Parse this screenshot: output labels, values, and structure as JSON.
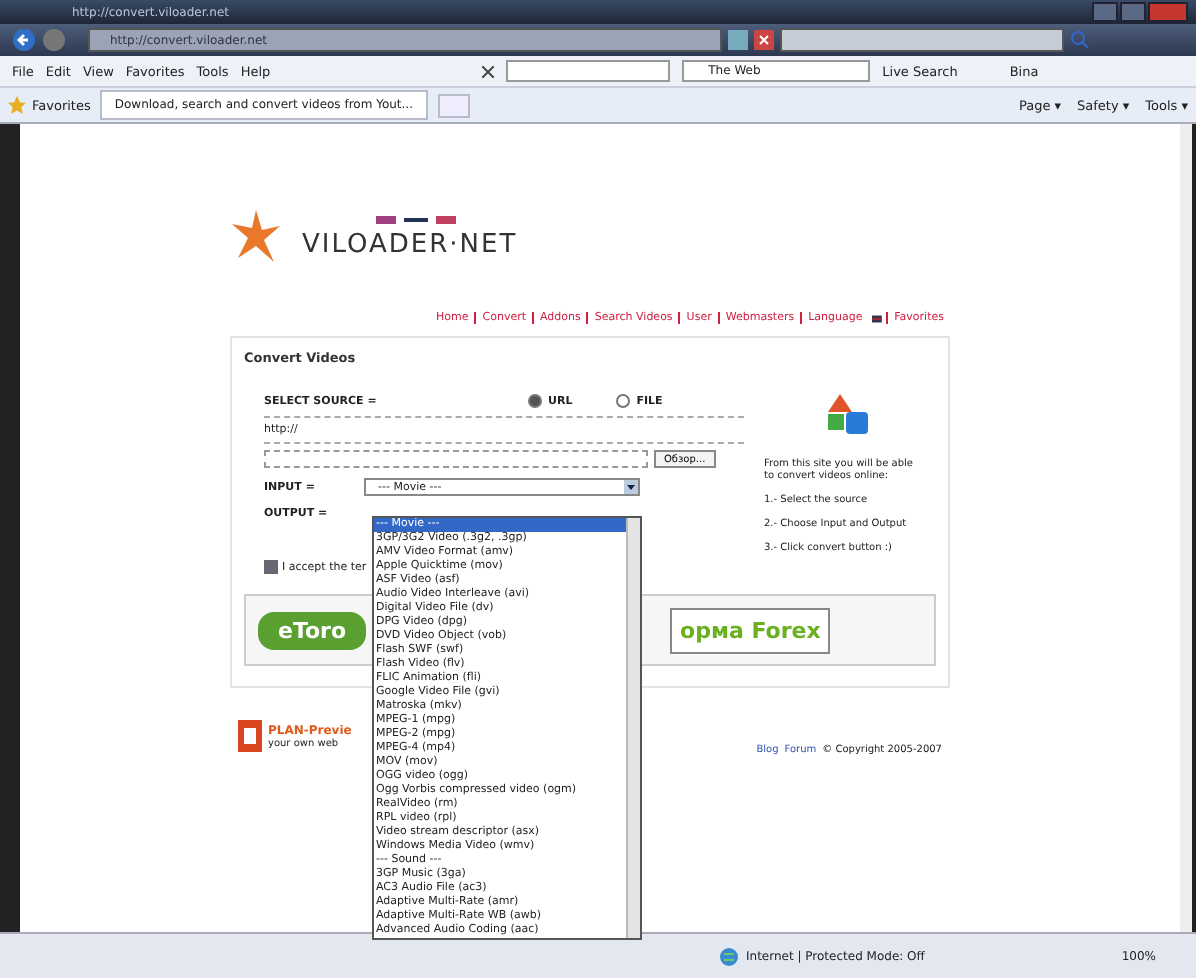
{
  "browser": {
    "title": "http://convert.viloader.net",
    "address": "http://convert.viloader.net",
    "menu": [
      "File",
      "Edit",
      "View",
      "Favorites",
      "Tools",
      "Help"
    ],
    "web_search": {
      "engine": "The Web"
    },
    "live_search": "Live Search",
    "toolbar_cut": "Bina",
    "favorites": "Favorites",
    "tab": {
      "label": "Download, search and convert videos from Yout...",
      "selected": true
    },
    "commands": [
      "Page ▾",
      "Safety ▾",
      "Tools ▾"
    ]
  },
  "page": {
    "logo": "VILOADER·NET",
    "nav": [
      "Home",
      "Convert",
      "Addons",
      "Search Videos",
      "User",
      "Webmasters",
      "Language",
      "Favorites"
    ],
    "panel": {
      "title": "Convert Videos",
      "source_label": "SELECT SOURCE =",
      "source_options": [
        {
          "label": "URL",
          "selected": true
        },
        {
          "label": "FILE",
          "selected": false
        }
      ],
      "url_value": "http://",
      "browse": "Обзор...",
      "input_label": "INPUT =",
      "input_value": "--- Movie ---",
      "output_label": "OUTPUT =",
      "accept": {
        "label": "I accept the ter",
        "checked": true
      },
      "info": [
        "From this site you will be able to convert videos online:",
        "1.- Select the source",
        "2.- Choose Input and Output",
        "3.- Click convert button :)"
      ],
      "banner": {
        "logo": "eToro",
        "text": "орма Forex"
      }
    },
    "dropdown": [
      {
        "label": "--- Movie ---",
        "selected": true
      },
      {
        "label": "3GP/3G2 Video (.3g2, .3gp)",
        "selected": false
      },
      {
        "label": "AMV Video Format (amv)",
        "selected": false
      },
      {
        "label": "Apple Quicktime (mov)",
        "selected": false
      },
      {
        "label": "ASF Video (asf)",
        "selected": false
      },
      {
        "label": "Audio Video Interleave (avi)",
        "selected": false
      },
      {
        "label": "Digital Video File (dv)",
        "selected": false
      },
      {
        "label": "DPG Video (dpg)",
        "selected": false
      },
      {
        "label": "DVD Video Object (vob)",
        "selected": false
      },
      {
        "label": "Flash SWF (swf)",
        "selected": false
      },
      {
        "label": "Flash Video (flv)",
        "selected": false
      },
      {
        "label": "FLIC Animation (fli)",
        "selected": false
      },
      {
        "label": "Google Video File (gvi)",
        "selected": false
      },
      {
        "label": "Matroska (mkv)",
        "selected": false
      },
      {
        "label": "MPEG-1 (mpg)",
        "selected": false
      },
      {
        "label": "MPEG-2 (mpg)",
        "selected": false
      },
      {
        "label": "MPEG-4 (mp4)",
        "selected": false
      },
      {
        "label": "MOV (mov)",
        "selected": false
      },
      {
        "label": "OGG video (ogg)",
        "selected": false
      },
      {
        "label": "Ogg Vorbis compressed video (ogm)",
        "selected": false
      },
      {
        "label": "RealVideo (rm)",
        "selected": false
      },
      {
        "label": "RPL video (rpl)",
        "selected": false
      },
      {
        "label": "Video stream descriptor (asx)",
        "selected": false
      },
      {
        "label": "Windows Media Video (wmv)",
        "selected": false
      },
      {
        "label": "--- Sound ---",
        "selected": false
      },
      {
        "label": "3GP Music (3ga)",
        "selected": false
      },
      {
        "label": "AC3 Audio File (ac3)",
        "selected": false
      },
      {
        "label": "Adaptive Multi-Rate (amr)",
        "selected": false
      },
      {
        "label": "Adaptive Multi-Rate WB (awb)",
        "selected": false
      },
      {
        "label": "Advanced Audio Coding (aac)",
        "selected": false
      }
    ],
    "plan": {
      "name": "PLAN-Previe",
      "tagline": "your own web"
    },
    "footer": {
      "links": [
        "Blog",
        "Forum"
      ],
      "copyright": "© Copyright 2005-2007"
    }
  },
  "status_bar": {
    "zone": "Internet | Protected Mode: Off",
    "zoom": "100%"
  }
}
